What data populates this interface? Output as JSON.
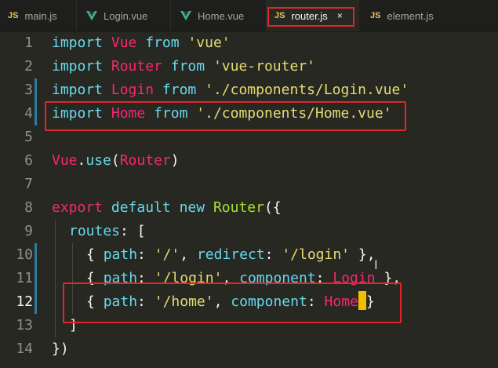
{
  "tabs": [
    {
      "label": "main.js",
      "type": "js"
    },
    {
      "label": "Login.vue",
      "type": "vue"
    },
    {
      "label": "Home.vue",
      "type": "vue"
    },
    {
      "label": "router.js",
      "type": "js",
      "active": true,
      "close": "×"
    },
    {
      "label": "element.js",
      "type": "js"
    }
  ],
  "icons": {
    "js": "JS",
    "vue": "vue-logo-icon"
  },
  "colors": {
    "background": "#272822",
    "keyword": "#66d9ef",
    "identifier": "#f92672",
    "string": "#e6db74",
    "function": "#a6e22e",
    "highlight_box": "#e0262b",
    "cursor": "#f0c000"
  },
  "editor": {
    "current_line": 12,
    "line_numbers": [
      "1",
      "2",
      "3",
      "4",
      "5",
      "6",
      "7",
      "8",
      "9",
      "10",
      "11",
      "12",
      "13",
      "14"
    ],
    "lines": {
      "l1": {
        "a": "import",
        "b": "Vue",
        "c": "from",
        "d": "'vue'"
      },
      "l2": {
        "a": "import",
        "b": "Router",
        "c": "from",
        "d": "'vue-router'"
      },
      "l3": {
        "a": "import",
        "b": "Login",
        "c": "from",
        "d": "'./components/Login.vue'"
      },
      "l4": {
        "a": "import",
        "b": "Home",
        "c": "from",
        "d": "'./components/Home.vue'"
      },
      "l6": {
        "a": "Vue",
        "b": ".",
        "c": "use",
        "d": "(",
        "e": "Router",
        "f": ")"
      },
      "l8": {
        "a": "export",
        "b": "default",
        "c": "new",
        "d": "Router",
        "e": "({"
      },
      "l9": {
        "a": "routes",
        "b": ": ["
      },
      "l10": {
        "a": "{ ",
        "b": "path",
        "c": ": ",
        "d": "'/'",
        "e": ", ",
        "f": "redirect",
        "g": ": ",
        "h": "'/login'",
        "i": " },"
      },
      "l11": {
        "a": "{ ",
        "b": "path",
        "c": ": ",
        "d": "'/login'",
        "e": ", ",
        "f": "component",
        "g": ": ",
        "h": "Login",
        "i": " },"
      },
      "l12": {
        "a": "{ ",
        "b": "path",
        "c": ": ",
        "d": "'/home'",
        "e": ", ",
        "f": "component",
        "g": ": ",
        "h": "Home",
        "i": "}"
      },
      "l13": {
        "a": "]"
      },
      "l14": {
        "a": "})"
      }
    }
  }
}
